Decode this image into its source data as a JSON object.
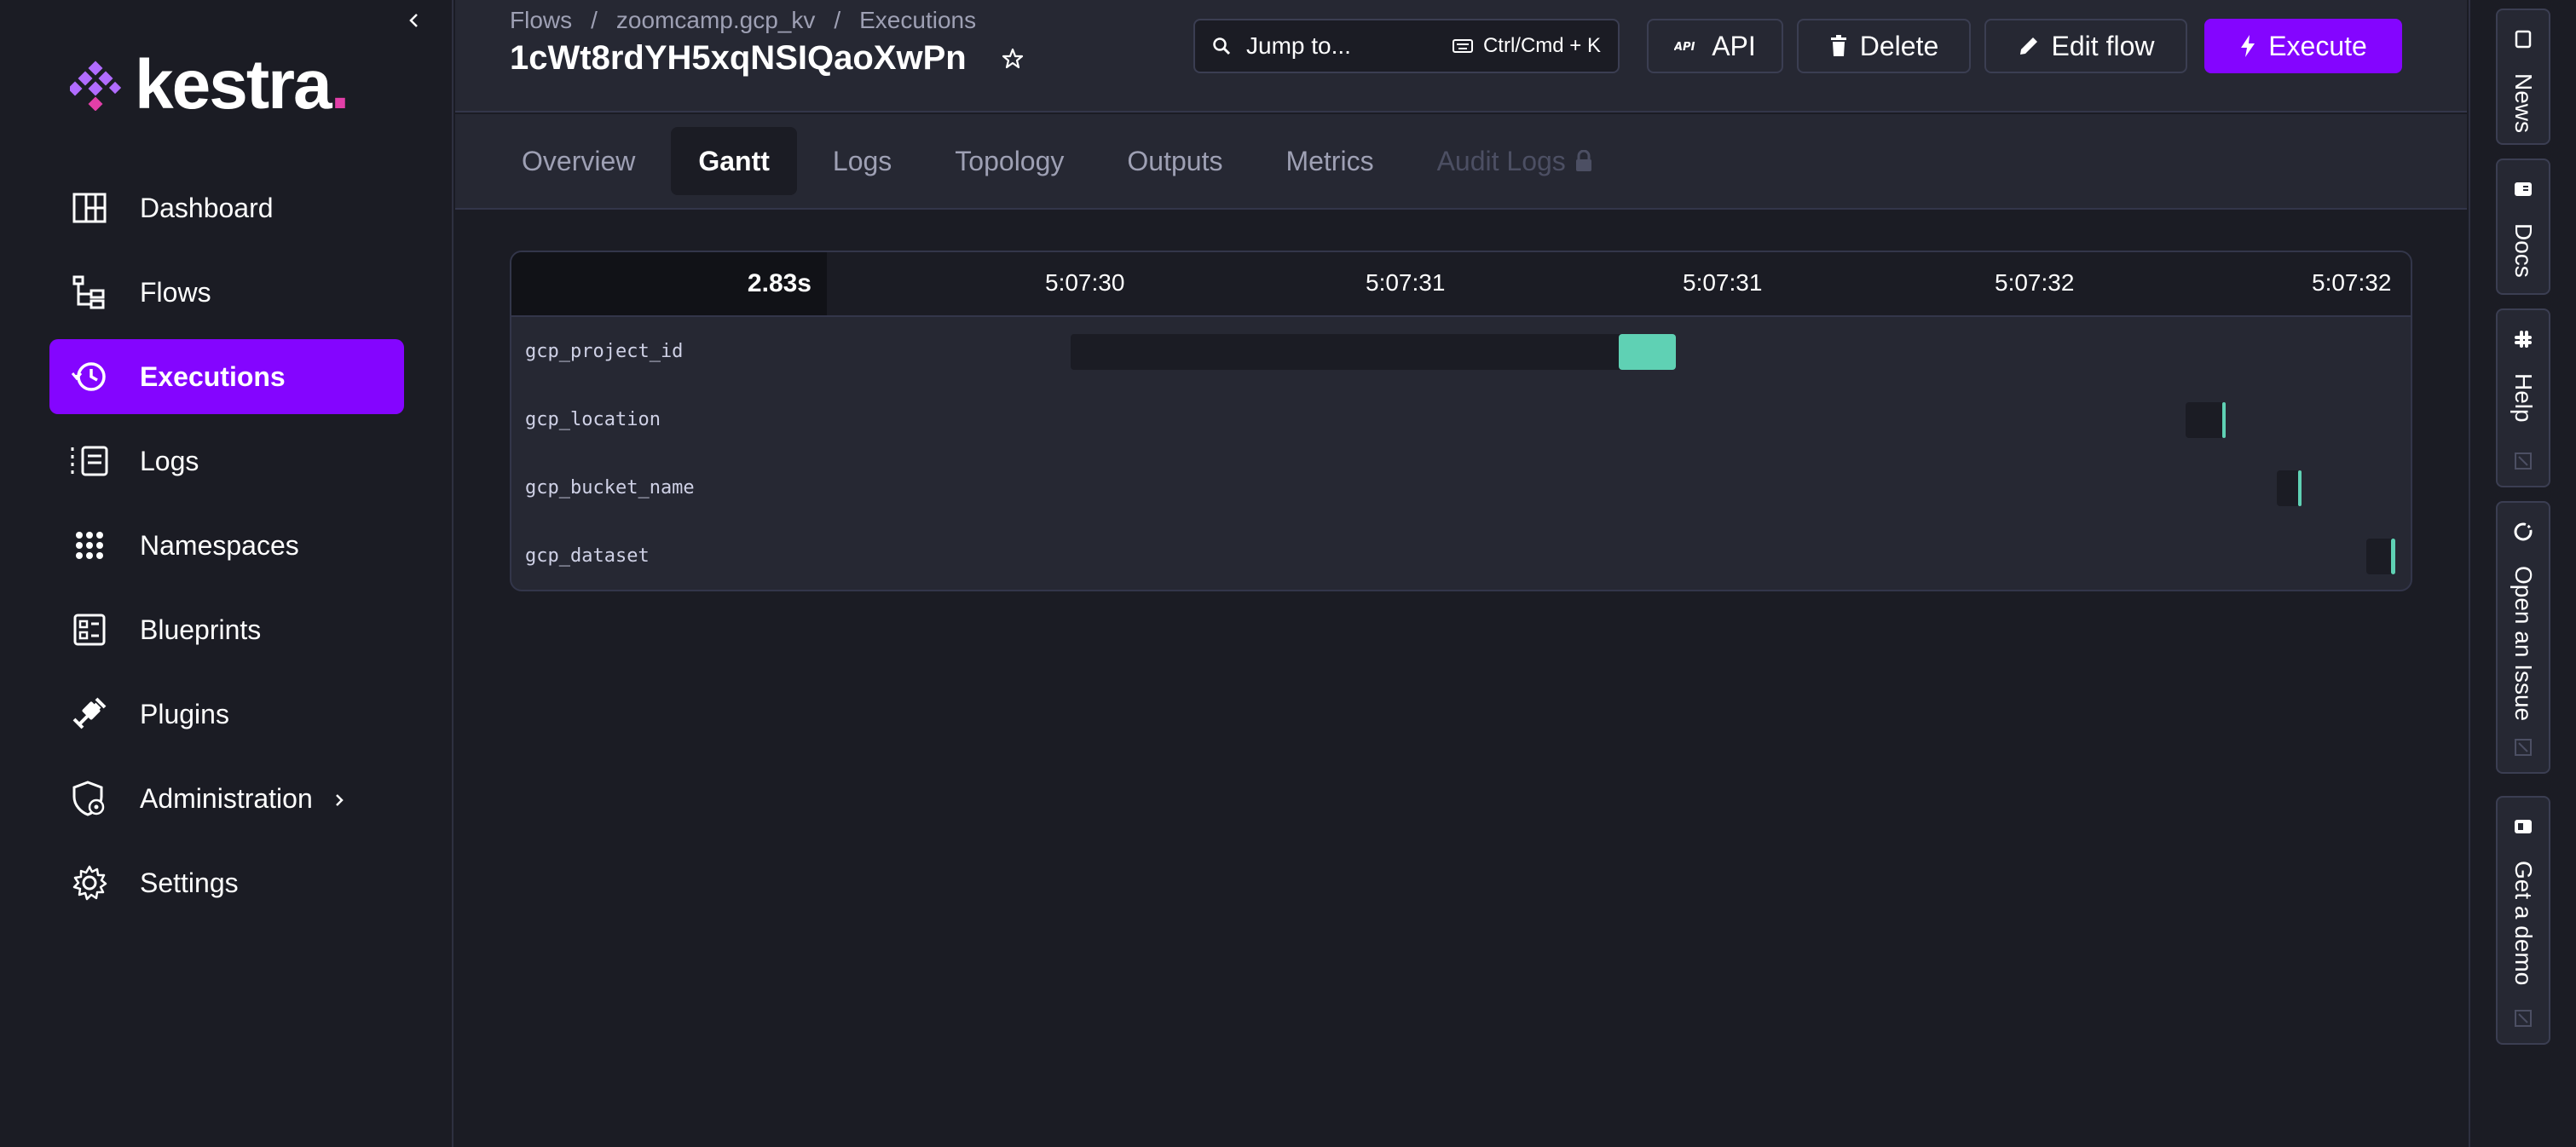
{
  "brand": {
    "name": "kestra",
    "dot": ".",
    "accent": "#8405ff",
    "logo_color": "#b16cff"
  },
  "sidebar": {
    "items": [
      {
        "label": "Dashboard",
        "icon": "dashboard-icon"
      },
      {
        "label": "Flows",
        "icon": "flows-icon"
      },
      {
        "label": "Executions",
        "icon": "executions-icon",
        "active": true
      },
      {
        "label": "Logs",
        "icon": "logs-icon"
      },
      {
        "label": "Namespaces",
        "icon": "namespaces-icon"
      },
      {
        "label": "Blueprints",
        "icon": "blueprints-icon"
      },
      {
        "label": "Plugins",
        "icon": "plugins-icon"
      },
      {
        "label": "Administration",
        "icon": "administration-icon"
      },
      {
        "label": "Settings",
        "icon": "settings-icon"
      }
    ]
  },
  "header": {
    "breadcrumb": [
      "Flows",
      "/",
      "zoomcamp.gcp_kv",
      "/",
      "Executions"
    ],
    "execution_id": "1cWt8rdYH5xqNSIQaoXwPn",
    "jump": {
      "label": "Jump to...",
      "shortcut": "Ctrl/Cmd + K"
    },
    "buttons": {
      "api": "API",
      "delete": "Delete",
      "edit": "Edit flow",
      "execute": "Execute"
    }
  },
  "tabs": [
    "Overview",
    "Gantt",
    "Logs",
    "Topology",
    "Outputs",
    "Metrics",
    "Audit Logs"
  ],
  "active_tab": "Gantt",
  "gantt": {
    "duration": "2.83s",
    "ticks": [
      "5:07:30",
      "5:07:31",
      "5:07:31",
      "5:07:32",
      "5:07:32"
    ],
    "tasks": [
      {
        "name": "gcp_project_id",
        "start": 0.294,
        "end": 0.612,
        "run_start": 0.582,
        "color": "#5fd1b4"
      },
      {
        "name": "gcp_location",
        "start": 0.88,
        "end": 0.901,
        "run_start": 0.899,
        "color": "#5fd1b4"
      },
      {
        "name": "gcp_bucket_name",
        "start": 0.928,
        "end": 0.941,
        "run_start": 0.939,
        "color": "#5fd1b4"
      },
      {
        "name": "gcp_dataset",
        "start": 0.975,
        "end": 0.99,
        "run_start": 0.988,
        "color": "#5fd1b4"
      }
    ]
  },
  "rail": [
    "News",
    "Docs",
    "Help",
    "Open an Issue",
    "Get a demo"
  ]
}
